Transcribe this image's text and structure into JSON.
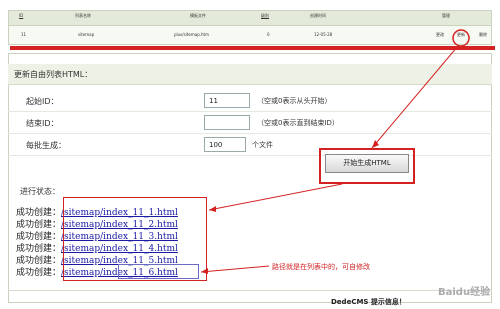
{
  "top_table": {
    "headers": {
      "id": "ID",
      "name": "列表名称",
      "template": "模板文件",
      "level": "级别",
      "created": "创建时间",
      "manage": "管理"
    },
    "row": {
      "id": "11",
      "name": "sitemap",
      "template": "plus/sitemap.htm",
      "level": "0",
      "created": "12-05-28",
      "action_edit": "更改",
      "action_update": "更新",
      "action_delete": "删除"
    }
  },
  "form": {
    "title": "更新自由列表HTML：",
    "start_id": {
      "label": "起始ID：",
      "value": "11",
      "hint": "（空或0表示从头开始）"
    },
    "end_id": {
      "label": "结束ID：",
      "value": "",
      "hint": "（空或0表示直到结束ID）"
    },
    "per_batch": {
      "label": "每批生成：",
      "value": "100",
      "unit": "个文件"
    },
    "submit_label": "开始生成HTML"
  },
  "progress": {
    "title": "进行状态：",
    "prefix": "成功创建：",
    "files": [
      "/sitemap/index_11_1.html",
      "/sitemap/index_11_2.html",
      "/sitemap/index_11_3.html",
      "/sitemap/index_11_4.html",
      "/sitemap/index_11_5.html",
      "/sitemap/index_11_6.html"
    ]
  },
  "annotation": "路径就是在列表中的，可自修改",
  "footer": "DedeCMS 提示信息！",
  "watermark": "Baidu经验",
  "colors": {
    "highlight": "#d42222",
    "link": "#1a1aa6",
    "header_bg": "#e3ead9"
  }
}
